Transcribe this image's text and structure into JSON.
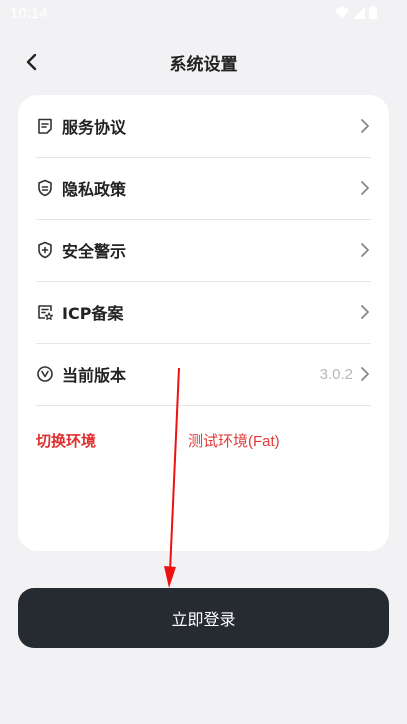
{
  "status_bar": {
    "time": "10:14"
  },
  "nav": {
    "title": "系统设置"
  },
  "settings": {
    "items": [
      {
        "label": "服务协议",
        "icon": "document-icon"
      },
      {
        "label": "隐私政策",
        "icon": "shield-lines-icon"
      },
      {
        "label": "安全警示",
        "icon": "shield-plus-icon"
      },
      {
        "label": "ICP备案",
        "icon": "certificate-icon"
      },
      {
        "label": "当前版本",
        "icon": "version-icon",
        "value": "3.0.2"
      }
    ],
    "environment": {
      "label": "切换环境",
      "value": "测试环境(Fat)"
    }
  },
  "login_button": {
    "label": "立即登录"
  },
  "colors": {
    "accent_red": "#e02e2e",
    "button_dark": "#262a31",
    "background": "#f2f2f4"
  }
}
